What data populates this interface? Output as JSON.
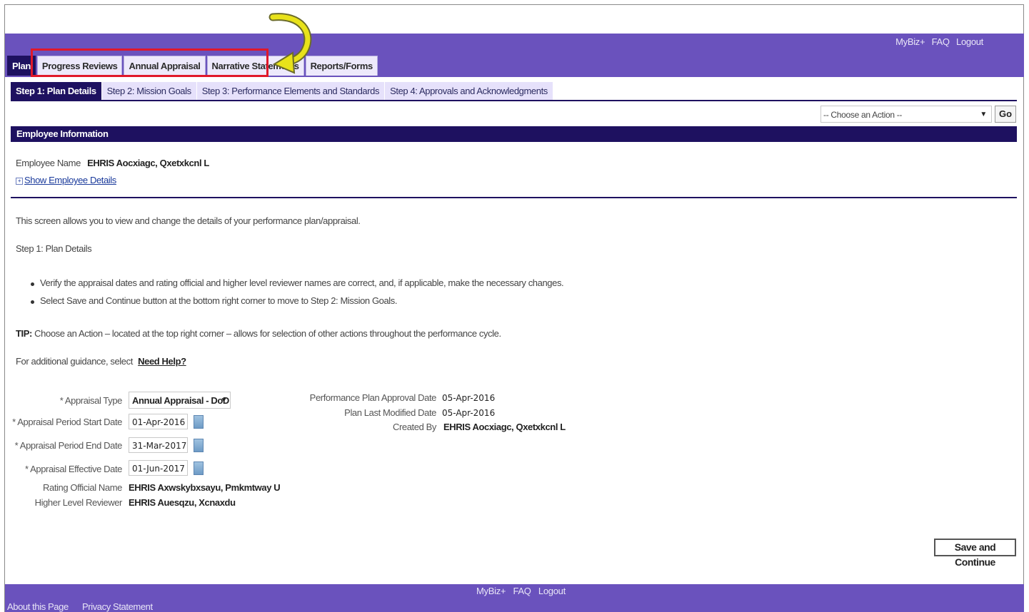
{
  "global_links": [
    "MyBiz+",
    "FAQ",
    "Logout"
  ],
  "tabs": [
    {
      "label": "Plan",
      "active": true
    },
    {
      "label": "Progress Reviews"
    },
    {
      "label": "Annual Appraisal"
    },
    {
      "label": "Narrative Statements"
    },
    {
      "label": "Reports/Forms"
    }
  ],
  "steps": [
    {
      "label": "Step 1: Plan Details",
      "active": true
    },
    {
      "label": "Step 2: Mission Goals"
    },
    {
      "label": "Step 3: Performance Elements and Standards"
    },
    {
      "label": "Step 4: Approvals and Acknowledgments"
    }
  ],
  "action": {
    "selected": "-- Choose an Action --",
    "go_label": "Go"
  },
  "employee_section": {
    "title": "Employee Information",
    "name_label": "Employee Name",
    "name_value": "EHRIS Aocxiagc, Qxetxkcnl L",
    "show_details": "Show Employee Details"
  },
  "instructions": {
    "intro": "This screen allows you to view and change the details of your performance plan/appraisal.",
    "step_title": "Step 1: Plan Details",
    "bullets": [
      "Verify the appraisal dates and rating official and higher level reviewer names are correct, and, if applicable, make the necessary changes.",
      "Select Save and Continue button at the bottom right corner to move to Step 2: Mission Goals."
    ],
    "tip_label": "TIP:",
    "tip_text": "Choose an Action – located at the top right corner – allows for selection of other actions throughout the performance cycle.",
    "help_prefix": "For additional guidance, select",
    "help_link": "Need Help?"
  },
  "form": {
    "appraisal_type_label": "* Appraisal Type",
    "appraisal_type_value": "Annual Appraisal - DoD",
    "start_date_label": "* Appraisal Period Start Date",
    "start_date_value": "01-Apr-2016",
    "end_date_label": "* Appraisal Period End Date",
    "end_date_value": "31-Mar-2017",
    "effective_date_label": "* Appraisal Effective Date",
    "effective_date_value": "01-Jun-2017",
    "rating_official_label": "Rating Official Name",
    "rating_official_value": "EHRIS Axwskybxsayu, Pmkmtway U",
    "reviewer_label": "Higher Level Reviewer",
    "reviewer_value": "EHRIS Auesqzu, Xcnaxdu",
    "approval_date_label": "Performance Plan Approval Date",
    "approval_date_value": "05-Apr-2016",
    "last_modified_label": "Plan Last Modified Date",
    "last_modified_value": "05-Apr-2016",
    "created_by_label": "Created By",
    "created_by_value": "EHRIS Aocxiagc, Qxetxkcnl L"
  },
  "save_button": "Save and Continue",
  "footer": {
    "links": [
      "MyBiz+",
      "FAQ",
      "Logout"
    ],
    "bottom_links": [
      "About this Page",
      "Privacy Statement"
    ]
  },
  "annotation": {
    "highlight_color": "#e0182a",
    "arrow_color": "#e8e21a",
    "arrow_icon": "curved-arrow-icon"
  }
}
